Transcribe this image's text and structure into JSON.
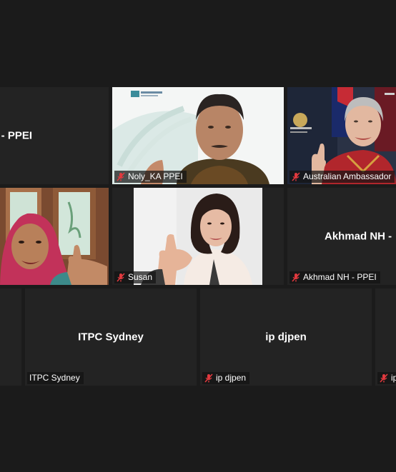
{
  "participants": [
    {
      "name": "Dila - PPEI",
      "label": "",
      "muted": false,
      "video": false
    },
    {
      "name": "Noly_KA PPEI",
      "label": "Noly_KA PPEI",
      "muted": true,
      "video": true
    },
    {
      "name": "Australian Ambassador",
      "label": "Australian Ambassador",
      "muted": true,
      "video": true
    },
    {
      "name": "",
      "label": "",
      "muted": false,
      "video": true
    },
    {
      "name": "Susan",
      "label": "Susan",
      "muted": true,
      "video": true
    },
    {
      "name": "Akhmad NH -",
      "label": "Akhmad NH - PPEI",
      "muted": true,
      "video": false
    },
    {
      "name": "ITPC Sydney",
      "label": "ITPC Sydney",
      "muted": false,
      "video": false
    },
    {
      "name": "ip djpen",
      "label": "ip djpen",
      "muted": true,
      "video": false
    },
    {
      "name": "",
      "label": "ip",
      "muted": true,
      "video": false
    }
  ],
  "colors": {
    "background": "#1b1b1b",
    "tile": "#232323",
    "muted": "#e0393e"
  },
  "icons": {
    "muted": "mic-muted-icon"
  }
}
